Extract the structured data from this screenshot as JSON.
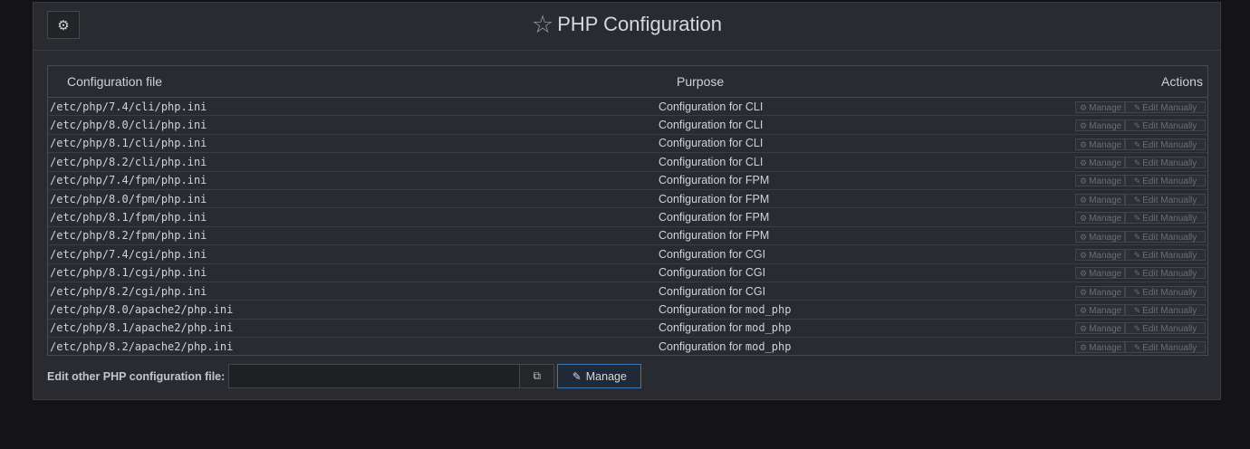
{
  "header": {
    "title": "PHP Configuration",
    "settings_icon": "gear-icon",
    "favorite_icon": "star-icon"
  },
  "table": {
    "columns": [
      "Configuration file",
      "Purpose",
      "Actions"
    ],
    "action_labels": {
      "manage": "Manage",
      "edit": "Edit Manually"
    },
    "rows": [
      {
        "file": "/etc/php/7.4/cli/php.ini",
        "purpose": "Configuration for",
        "target": "CLI",
        "mono": false
      },
      {
        "file": "/etc/php/8.0/cli/php.ini",
        "purpose": "Configuration for",
        "target": "CLI",
        "mono": false
      },
      {
        "file": "/etc/php/8.1/cli/php.ini",
        "purpose": "Configuration for",
        "target": "CLI",
        "mono": false
      },
      {
        "file": "/etc/php/8.2/cli/php.ini",
        "purpose": "Configuration for",
        "target": "CLI",
        "mono": false
      },
      {
        "file": "/etc/php/7.4/fpm/php.ini",
        "purpose": "Configuration for",
        "target": "FPM",
        "mono": false
      },
      {
        "file": "/etc/php/8.0/fpm/php.ini",
        "purpose": "Configuration for",
        "target": "FPM",
        "mono": false
      },
      {
        "file": "/etc/php/8.1/fpm/php.ini",
        "purpose": "Configuration for",
        "target": "FPM",
        "mono": false
      },
      {
        "file": "/etc/php/8.2/fpm/php.ini",
        "purpose": "Configuration for",
        "target": "FPM",
        "mono": false
      },
      {
        "file": "/etc/php/7.4/cgi/php.ini",
        "purpose": "Configuration for",
        "target": "CGI",
        "mono": false
      },
      {
        "file": "/etc/php/8.1/cgi/php.ini",
        "purpose": "Configuration for",
        "target": "CGI",
        "mono": false
      },
      {
        "file": "/etc/php/8.2/cgi/php.ini",
        "purpose": "Configuration for",
        "target": "CGI",
        "mono": false
      },
      {
        "file": "/etc/php/8.0/apache2/php.ini",
        "purpose": "Configuration for",
        "target": "mod_php",
        "mono": true
      },
      {
        "file": "/etc/php/8.1/apache2/php.ini",
        "purpose": "Configuration for",
        "target": "mod_php",
        "mono": true
      },
      {
        "file": "/etc/php/8.2/apache2/php.ini",
        "purpose": "Configuration for",
        "target": "mod_php",
        "mono": true
      }
    ]
  },
  "footer": {
    "label": "Edit other PHP configuration file:",
    "input_value": "",
    "manage_label": "Manage",
    "copy_icon": "copy-icon",
    "edit_icon": "pencil-square-icon"
  },
  "colors": {
    "background": "#141416",
    "panel": "#2a2b30",
    "accent_border": "#3a78b8"
  }
}
